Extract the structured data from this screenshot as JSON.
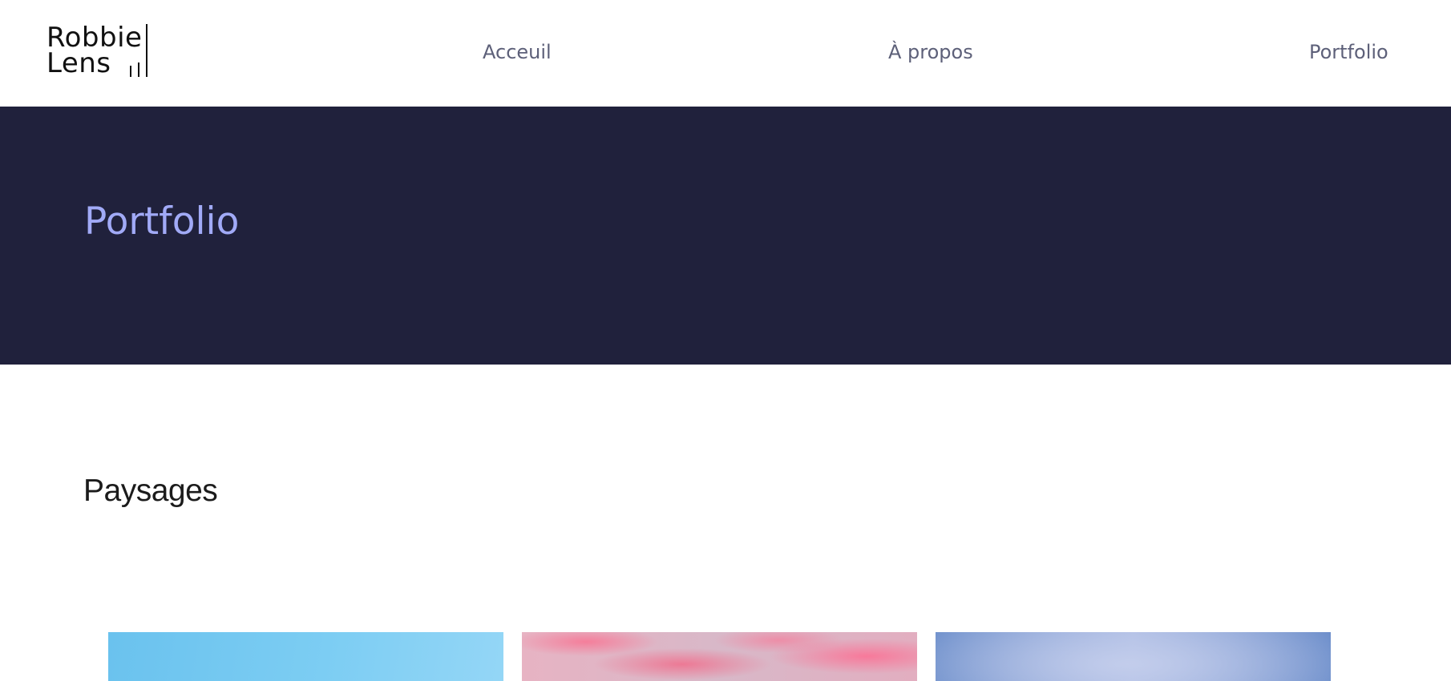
{
  "header": {
    "logo": {
      "line1": "Robbie",
      "line2": "Lens"
    },
    "nav": {
      "home": "Acceuil",
      "about": "À propos",
      "portfolio": "Portfolio"
    }
  },
  "hero": {
    "title": "Portfolio"
  },
  "section": {
    "title": "Paysages"
  },
  "colors": {
    "hero_background": "#20213c",
    "hero_title": "#a1aaf7",
    "nav_text": "#5d6079"
  }
}
